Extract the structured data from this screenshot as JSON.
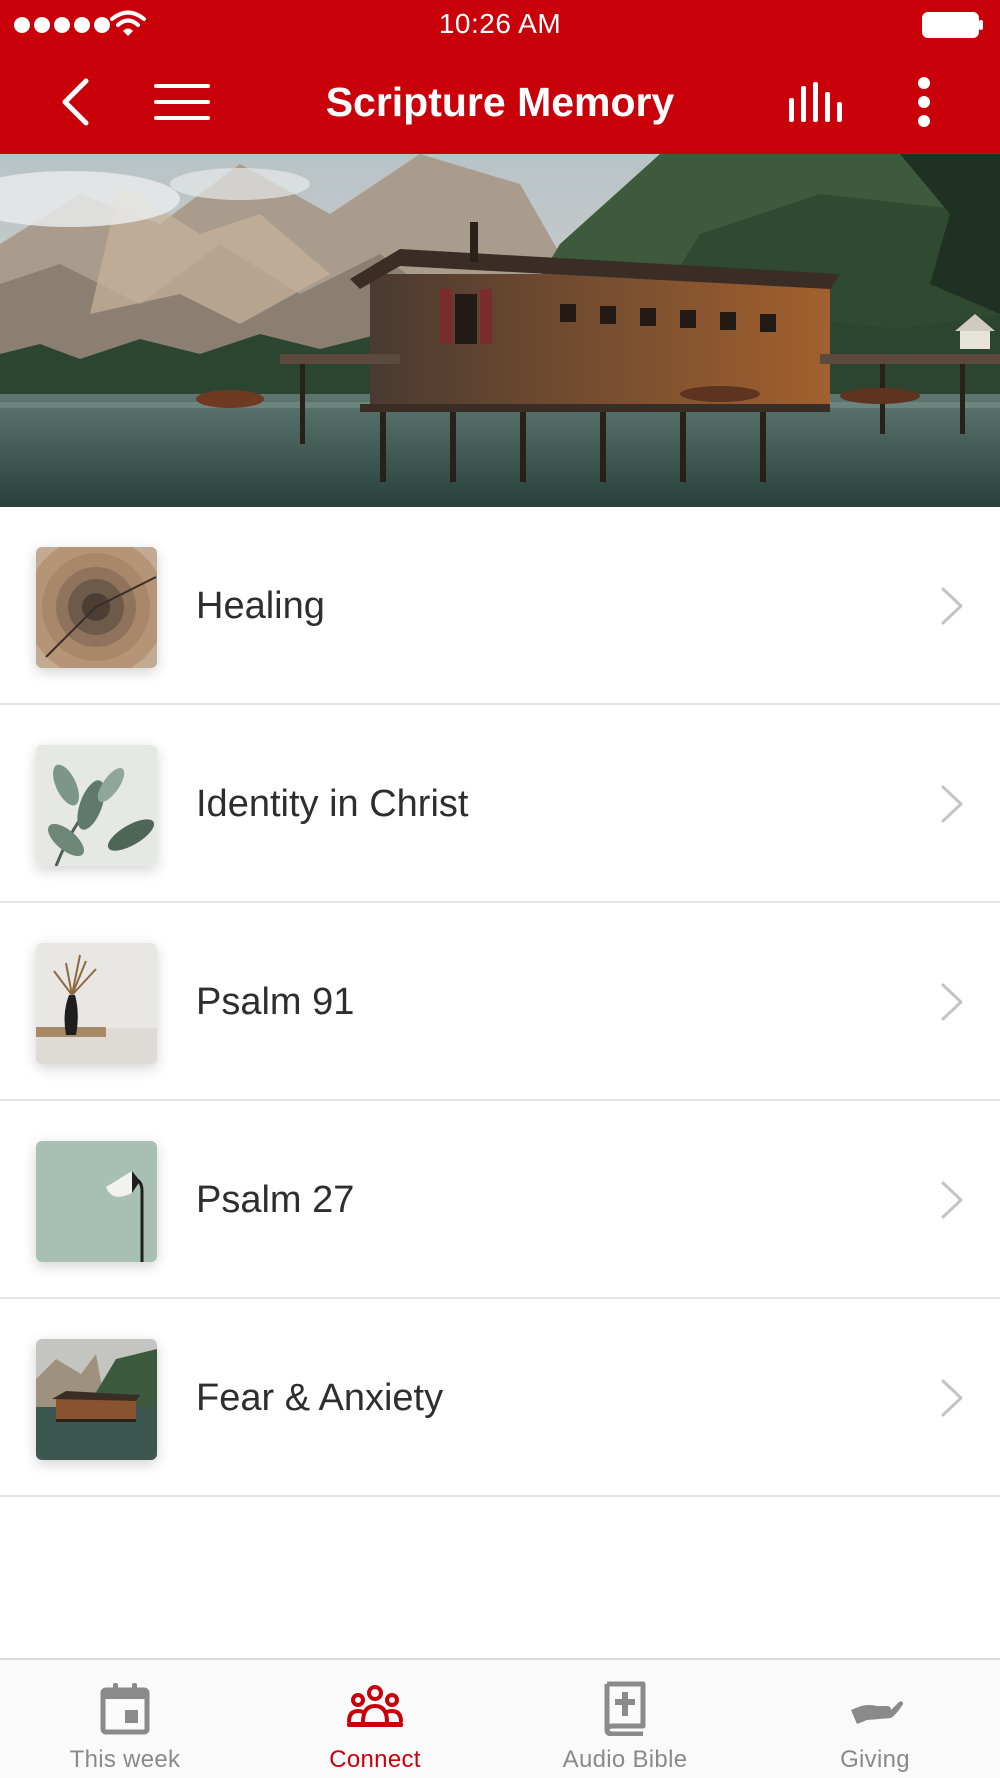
{
  "status_bar": {
    "time": "10:26 AM",
    "icons": [
      "signal-icon",
      "wifi-icon",
      "battery-icon"
    ]
  },
  "nav": {
    "title": "Scripture Memory",
    "icons": [
      "back-arrow-icon",
      "menu-icon",
      "stats-icon",
      "more-vertical-icon"
    ]
  },
  "hero": {
    "image": "lake-boathouse-mountains"
  },
  "list": {
    "items": [
      {
        "label": "Healing",
        "thumbnail": "tree-rings"
      },
      {
        "label": "Identity in Christ",
        "thumbnail": "leafy-plant"
      },
      {
        "label": "Psalm 91",
        "thumbnail": "vase-with-dried-grass"
      },
      {
        "label": "Psalm 27",
        "thumbnail": "desk-lamp"
      },
      {
        "label": "Fear & Anxiety",
        "thumbnail": "lake-boathouse"
      }
    ]
  },
  "tabbar": {
    "tabs": [
      {
        "label": "This week",
        "icon": "calendar-icon",
        "active": false
      },
      {
        "label": "Connect",
        "icon": "group-icon",
        "active": true
      },
      {
        "label": "Audio Bible",
        "icon": "bible-icon",
        "active": false
      },
      {
        "label": "Giving",
        "icon": "giving-hand-icon",
        "active": false
      }
    ]
  },
  "colors": {
    "brand_red": "#c90009",
    "inactive_gray": "#8a8a8a",
    "divider": "#e4e4e4"
  }
}
